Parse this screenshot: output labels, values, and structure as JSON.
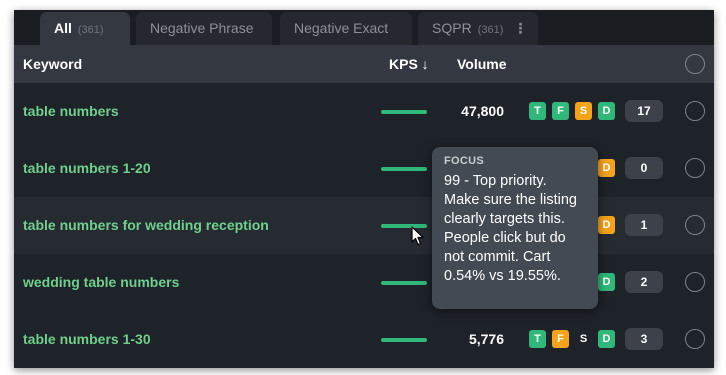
{
  "tabs": [
    {
      "label": "All",
      "count": "(361)"
    },
    {
      "label": "Negative Phrase"
    },
    {
      "label": "Negative Exact"
    },
    {
      "label": "SQPR",
      "count": "(361)",
      "more": "⋮"
    }
  ],
  "table": {
    "headers": {
      "keyword": "Keyword",
      "kps": "KPS ↓",
      "volume": "Volume"
    },
    "rows": [
      {
        "keyword": "table numbers",
        "kps_level": 1.0,
        "volume": "47,800",
        "badges": [
          "T",
          "F",
          "S",
          "D"
        ],
        "count": "17"
      },
      {
        "keyword": "table numbers 1-20",
        "kps_level": 1.0,
        "volume": "",
        "badges": [
          "D"
        ],
        "count": "0"
      },
      {
        "keyword": "table numbers for wedding reception",
        "kps_level": 1.0,
        "volume": "",
        "badges": [
          "D"
        ],
        "count": "1"
      },
      {
        "keyword": "wedding table numbers",
        "kps_level": 1.0,
        "volume": "",
        "badges": [
          "D"
        ],
        "count": "2"
      },
      {
        "keyword": "table numbers 1-30",
        "kps_level": 1.0,
        "volume": "5,776",
        "badges": [
          "T",
          "F",
          "S",
          "D"
        ],
        "count": "3"
      }
    ]
  },
  "tooltip": {
    "title": "FOCUS",
    "body": "99 - Top priority. Make sure the listing clearly targets this. People click but do not commit. Cart 0.54% vs 19.55%."
  },
  "colors": {
    "green": "#2fb87a",
    "orange": "#f5a31a",
    "keyword_green": "#6fd08c",
    "panel_bg": "#1e2229"
  }
}
